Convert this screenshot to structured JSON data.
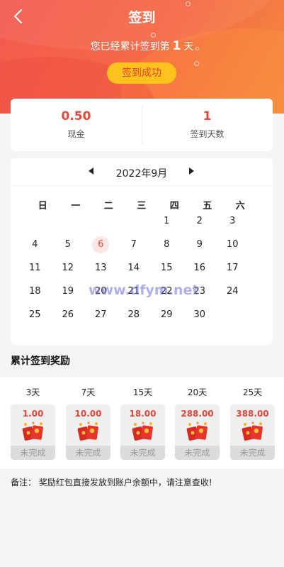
{
  "header": {
    "title": "签到",
    "subtitle_prefix": "您已经累计签到第",
    "signed_days": "1",
    "subtitle_suffix": "天",
    "signed_button": "签到成功"
  },
  "stats": [
    {
      "value": "0.50",
      "label": "现金"
    },
    {
      "value": "1",
      "label": "签到天数"
    }
  ],
  "calendar": {
    "month_label": "2022年9月",
    "weekdays": [
      "日",
      "一",
      "二",
      "三",
      "四",
      "五",
      "六"
    ],
    "today": 6,
    "days": [
      "1",
      "2",
      "3",
      "4",
      "5",
      "6",
      "7",
      "8",
      "9",
      "10",
      "11",
      "12",
      "13",
      "14",
      "15",
      "16",
      "17",
      "18",
      "19",
      "20",
      "21",
      "22",
      "23",
      "24",
      "25",
      "26",
      "27",
      "28",
      "29",
      "30"
    ]
  },
  "watermark": "www.dfym.net",
  "rewards": {
    "title": "累计签到奖励",
    "items": [
      {
        "days": "3天",
        "amount": "1.00",
        "status": "未完成"
      },
      {
        "days": "7天",
        "amount": "10.00",
        "status": "未完成"
      },
      {
        "days": "15天",
        "amount": "18.00",
        "status": "未完成"
      },
      {
        "days": "20天",
        "amount": "288.00",
        "status": "未完成"
      },
      {
        "days": "25天",
        "amount": "388.00",
        "status": "未完成"
      }
    ]
  },
  "note": "备注： 奖励红包直接发放到账户余额中，请注意查收!",
  "colors": {
    "accent": "#e5473a",
    "button": "#fdc21c",
    "header_start": "#f25a4f",
    "header_end": "#f48a3e"
  }
}
